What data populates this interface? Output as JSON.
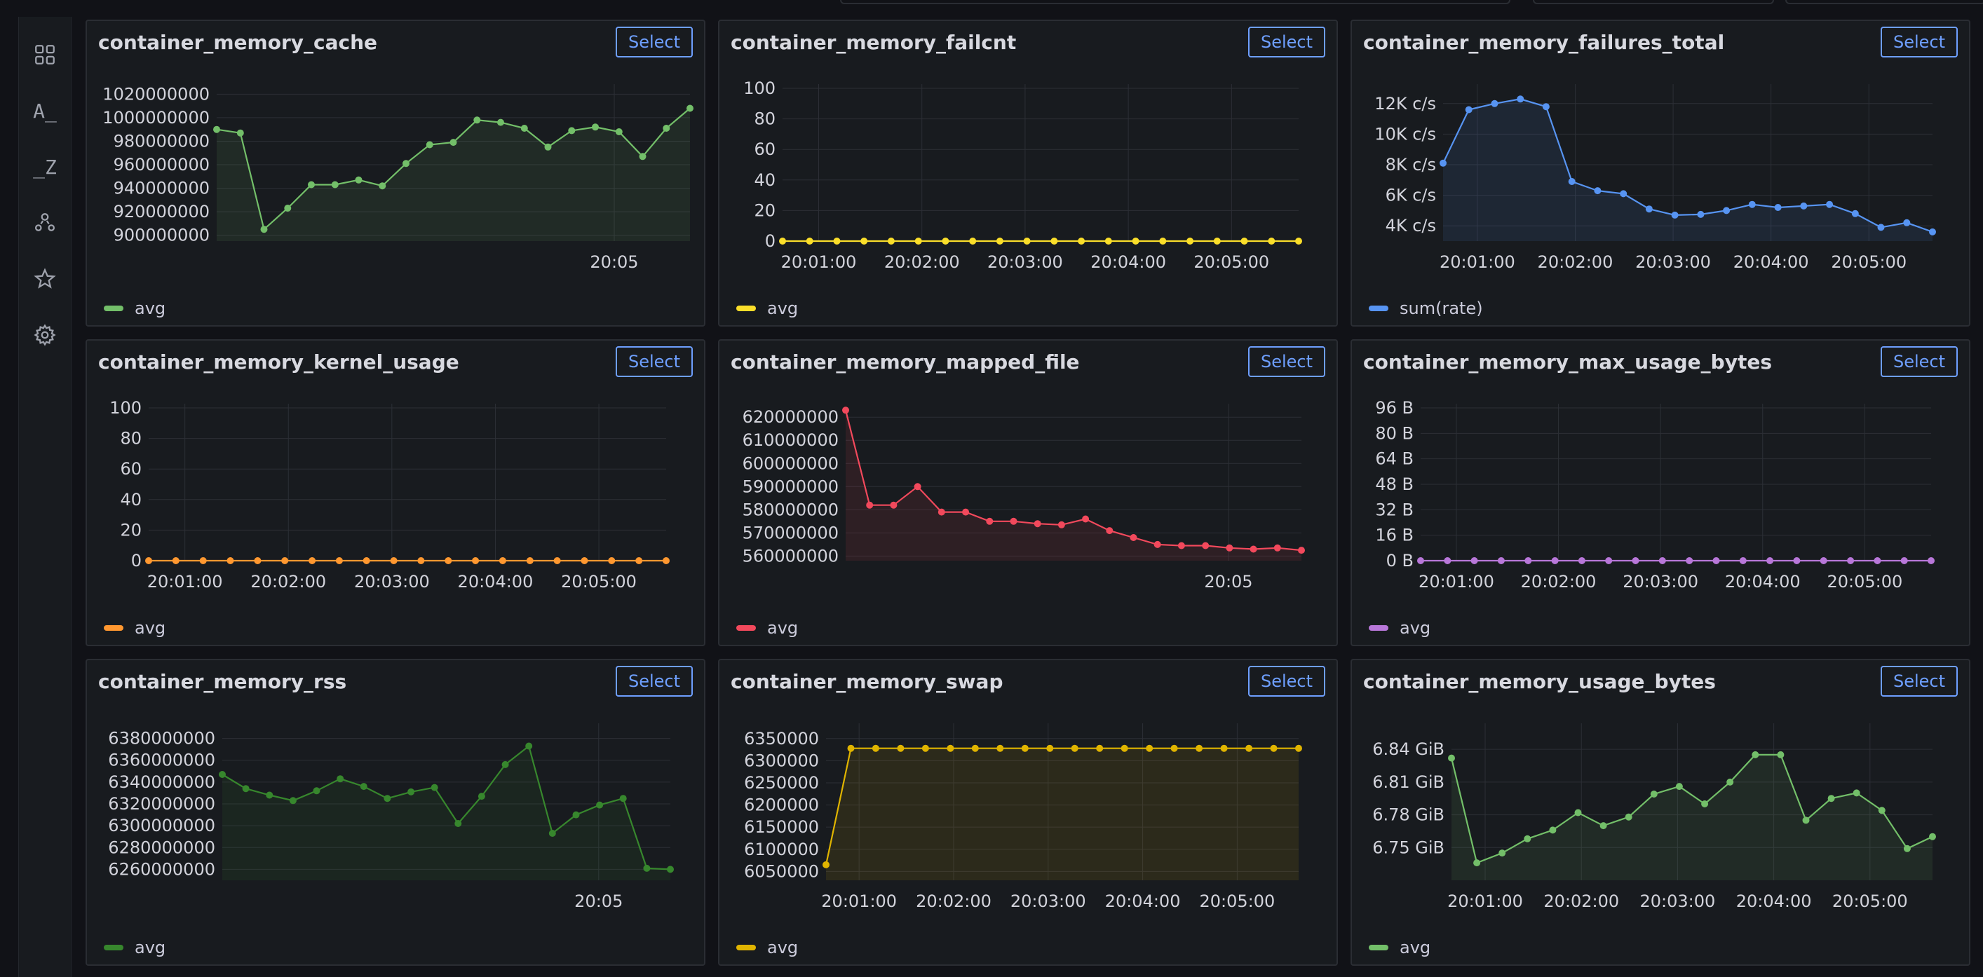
{
  "sidebar": {
    "items": [
      {
        "icon": "dashboards-icon"
      },
      {
        "icon": "sort-ascending-icon",
        "text": "A_"
      },
      {
        "icon": "sort-descending-icon",
        "text": "_Z"
      },
      {
        "icon": "users-icon"
      },
      {
        "icon": "star-icon"
      },
      {
        "icon": "gear-icon"
      }
    ]
  },
  "select_label": "Select",
  "chart_data": [
    {
      "title": "container_memory_cache",
      "type": "area",
      "color": "#73bf69",
      "legend": "avg",
      "x_mode": "time_single",
      "xtick_labels": [
        "20:05"
      ],
      "ytick_labels": [
        "1020000000",
        "1000000000",
        "980000000",
        "960000000",
        "940000000",
        "920000000",
        "900000000"
      ],
      "ylim": [
        895000000,
        1025000000
      ],
      "values": [
        990000000,
        987000000,
        905000000,
        923000000,
        943000000,
        943000000,
        947000000,
        942000000,
        961000000,
        977000000,
        979000000,
        998000000,
        996000000,
        991000000,
        975000000,
        989000000,
        992000000,
        988000000,
        967000000,
        991000000,
        1008000000
      ]
    },
    {
      "title": "container_memory_failcnt",
      "type": "line",
      "color": "#fade2a",
      "legend": "avg",
      "x_mode": "time",
      "xtick_labels": [
        "20:01:00",
        "20:02:00",
        "20:03:00",
        "20:04:00",
        "20:05:00"
      ],
      "ytick_labels": [
        "100",
        "80",
        "60",
        "40",
        "20",
        "0"
      ],
      "ylim": [
        0,
        100
      ],
      "values": [
        0,
        0,
        0,
        0,
        0,
        0,
        0,
        0,
        0,
        0,
        0,
        0,
        0,
        0,
        0,
        0,
        0,
        0,
        0,
        0
      ]
    },
    {
      "title": "container_memory_failures_total",
      "type": "area",
      "color": "#5794f2",
      "legend": "sum(rate)",
      "x_mode": "time",
      "xtick_labels": [
        "20:01:00",
        "20:02:00",
        "20:03:00",
        "20:04:00",
        "20:05:00"
      ],
      "ytick_labels": [
        "12K c/s",
        "10K c/s",
        "8K c/s",
        "6K c/s",
        "4K c/s"
      ],
      "ylim": [
        3000,
        13000
      ],
      "values": [
        8100,
        11600,
        12000,
        12300,
        11800,
        6900,
        6300,
        6100,
        5100,
        4700,
        4750,
        5000,
        5400,
        5200,
        5300,
        5400,
        4800,
        3900,
        4200,
        3600
      ]
    },
    {
      "title": "container_memory_kernel_usage",
      "type": "line",
      "color": "#ff9830",
      "legend": "avg",
      "x_mode": "time",
      "xtick_labels": [
        "20:01:00",
        "20:02:00",
        "20:03:00",
        "20:04:00",
        "20:05:00"
      ],
      "ytick_labels": [
        "100",
        "80",
        "60",
        "40",
        "20",
        "0"
      ],
      "ylim": [
        0,
        100
      ],
      "values": [
        0,
        0,
        0,
        0,
        0,
        0,
        0,
        0,
        0,
        0,
        0,
        0,
        0,
        0,
        0,
        0,
        0,
        0,
        0,
        0
      ]
    },
    {
      "title": "container_memory_mapped_file",
      "type": "area",
      "color": "#f2495c",
      "legend": "avg",
      "x_mode": "time_single",
      "xtick_labels": [
        "20:05"
      ],
      "ytick_labels": [
        "620000000",
        "610000000",
        "600000000",
        "590000000",
        "580000000",
        "570000000",
        "560000000"
      ],
      "ylim": [
        558000000,
        624000000
      ],
      "values": [
        623000000,
        582000000,
        582000000,
        590000000,
        579000000,
        579000000,
        575000000,
        575000000,
        574000000,
        573500000,
        576000000,
        571000000,
        568000000,
        565000000,
        564500000,
        564500000,
        563500000,
        563000000,
        563500000,
        562500000
      ]
    },
    {
      "title": "container_memory_max_usage_bytes",
      "type": "line",
      "color": "#b877d9",
      "legend": "avg",
      "x_mode": "time",
      "xtick_labels": [
        "20:01:00",
        "20:02:00",
        "20:03:00",
        "20:04:00",
        "20:05:00"
      ],
      "ytick_labels": [
        "96 B",
        "80 B",
        "64 B",
        "48 B",
        "32 B",
        "16 B",
        "0 B"
      ],
      "ylim": [
        0,
        96
      ],
      "values": [
        0,
        0,
        0,
        0,
        0,
        0,
        0,
        0,
        0,
        0,
        0,
        0,
        0,
        0,
        0,
        0,
        0,
        0,
        0,
        0
      ]
    },
    {
      "title": "container_memory_rss",
      "type": "area",
      "color": "#37872d",
      "legend": "avg",
      "x_mode": "time_single",
      "xtick_labels": [
        "20:05"
      ],
      "ytick_labels": [
        "6380000000",
        "6360000000",
        "6340000000",
        "6320000000",
        "6300000000",
        "6280000000",
        "6260000000"
      ],
      "ylim": [
        6250000000,
        6390000000
      ],
      "values": [
        6347000000,
        6334000000,
        6328000000,
        6323000000,
        6332000000,
        6343000000,
        6336000000,
        6325000000,
        6331000000,
        6335000000,
        6302000000,
        6327000000,
        6356000000,
        6373000000,
        6293000000,
        6310000000,
        6319000000,
        6325000000,
        6261000000,
        6260000000
      ]
    },
    {
      "title": "container_memory_swap",
      "type": "area",
      "color": "#e0b400",
      "legend": "avg",
      "x_mode": "time",
      "xtick_labels": [
        "20:01:00",
        "20:02:00",
        "20:03:00",
        "20:04:00",
        "20:05:00"
      ],
      "ytick_labels": [
        "6350000",
        "6300000",
        "6250000",
        "6200000",
        "6150000",
        "6100000",
        "6050000"
      ],
      "ylim": [
        6030000,
        6375000
      ],
      "values": [
        6065000,
        6328000,
        6328000,
        6328000,
        6328000,
        6328000,
        6328000,
        6328000,
        6328000,
        6328000,
        6328000,
        6328000,
        6328000,
        6328000,
        6328000,
        6328000,
        6328000,
        6328000,
        6328000,
        6328000
      ]
    },
    {
      "title": "container_memory_usage_bytes",
      "type": "area",
      "color": "#73bf69",
      "legend": "avg",
      "x_mode": "time",
      "xtick_labels": [
        "20:01:00",
        "20:02:00",
        "20:03:00",
        "20:04:00",
        "20:05:00"
      ],
      "ytick_labels": [
        "6.84 GiB",
        "6.81 GiB",
        "6.78 GiB",
        "6.75 GiB"
      ],
      "ylim": [
        6.72,
        6.86
      ],
      "values": [
        6.832,
        6.736,
        6.745,
        6.758,
        6.766,
        6.782,
        6.77,
        6.778,
        6.799,
        6.806,
        6.79,
        6.81,
        6.835,
        6.835,
        6.775,
        6.795,
        6.8,
        6.784,
        6.749,
        6.76
      ]
    }
  ]
}
